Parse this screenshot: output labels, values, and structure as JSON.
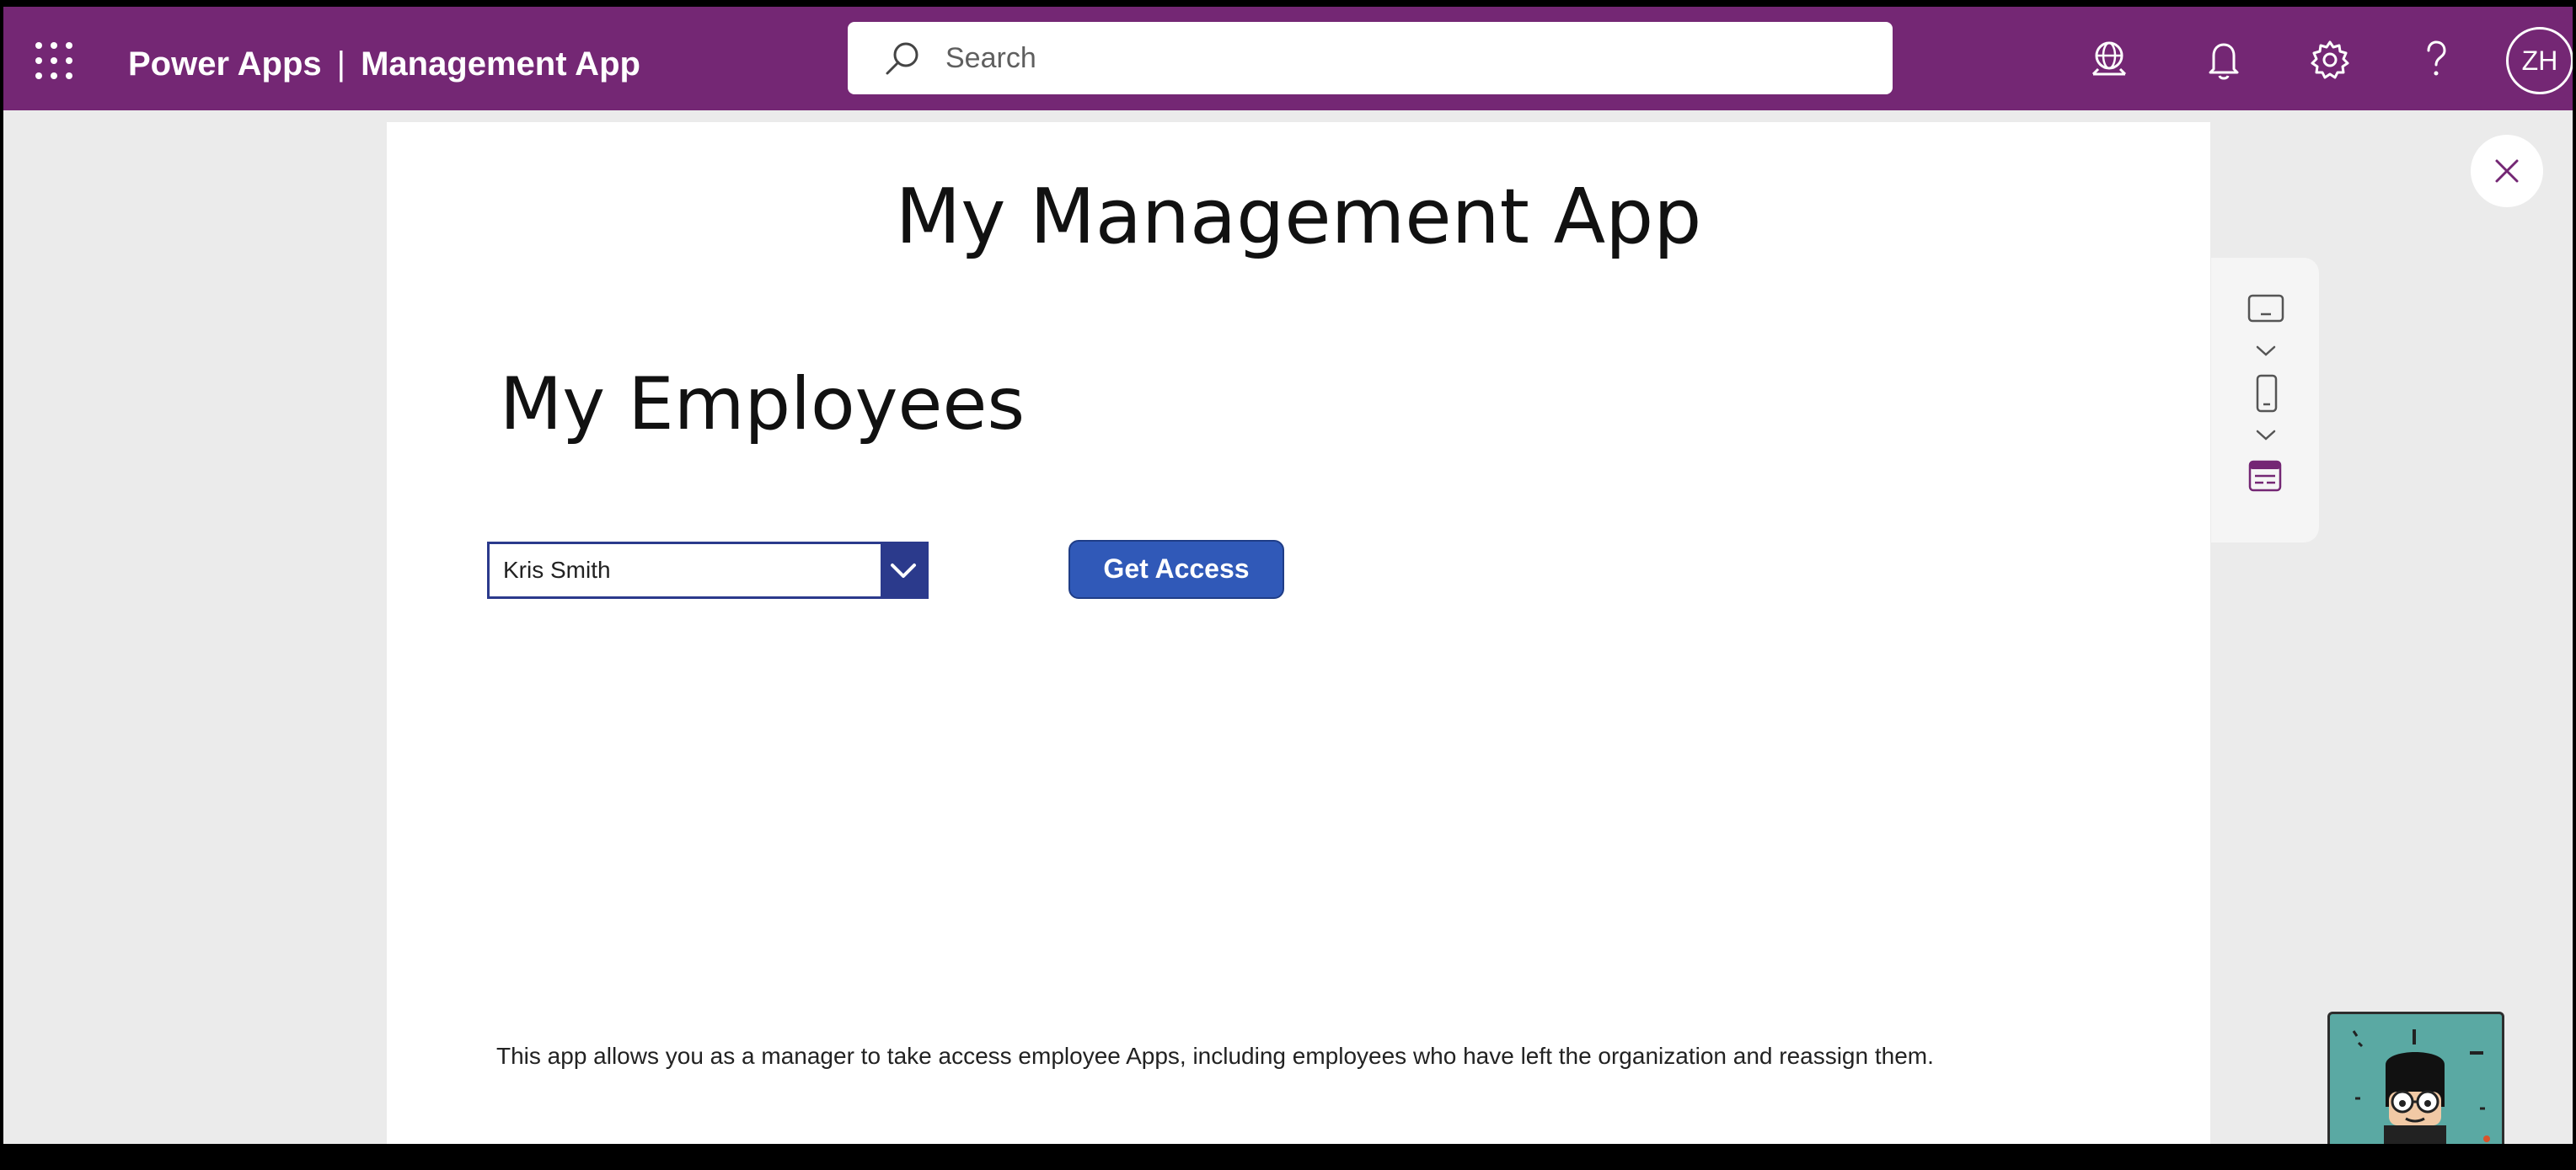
{
  "header": {
    "product": "Power Apps",
    "separator": "|",
    "app_name": "Management App",
    "search_placeholder": "Search",
    "avatar_initials": "ZH",
    "bar_color": "#742774",
    "icons": [
      "waffle-icon",
      "search-icon",
      "globe-icon",
      "bell-icon",
      "gear-icon",
      "help-icon"
    ]
  },
  "canvas": {
    "app_title": "My Management App",
    "section_title": "My Employees",
    "employee_dropdown": {
      "selected": "Kris Smith"
    },
    "get_access_label": "Get Access",
    "footer_text": "This app allows you as a manager to take access employee Apps, including employees who have left the organization and reassign them."
  },
  "side_panel": {
    "icons": [
      "tablet-icon",
      "chevron-down-icon",
      "phone-icon",
      "chevron-down-icon",
      "screen-layout-icon"
    ]
  },
  "colors": {
    "accent": "#742774",
    "button": "#3059b8",
    "dropdown_border": "#2b3a8c"
  }
}
